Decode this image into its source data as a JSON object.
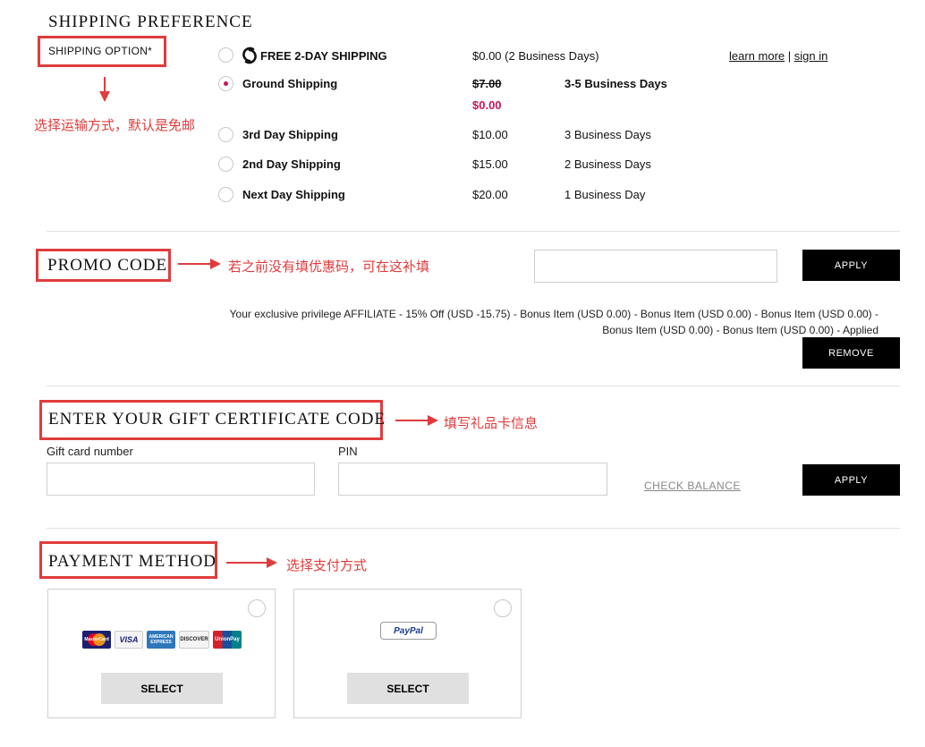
{
  "shipping": {
    "title": "SHIPPING PREFERENCE",
    "option_label": "SHIPPING OPTION*",
    "note": "选择运输方式，默认是免邮",
    "options": [
      {
        "name": "FREE 2-DAY SHIPPING",
        "price": "$0.00 (2 Business Days)",
        "icon": "shoprunner-s-icon"
      },
      {
        "name": "Ground Shipping",
        "price_old": "$7.00",
        "price": "$0.00",
        "days": "3-5 Business Days",
        "selected": true
      },
      {
        "name": "3rd Day Shipping",
        "price": "$10.00",
        "days": "3 Business Days"
      },
      {
        "name": "2nd Day Shipping",
        "price": "$15.00",
        "days": "2 Business Days"
      },
      {
        "name": "Next Day Shipping",
        "price": "$20.00",
        "days": "1 Business Day"
      }
    ],
    "learn_more": "learn more",
    "separator": "|",
    "sign_in": "sign in"
  },
  "promo": {
    "title": "PROMO CODE",
    "note": "若之前没有填优惠码，可在这补填",
    "apply_label": "APPLY",
    "privilege_line1": "Your exclusive privilege AFFILIATE - 15% Off (USD -15.75) - Bonus Item (USD 0.00) - Bonus Item (USD 0.00) - Bonus Item (USD 0.00) -",
    "privilege_line2": "Bonus Item (USD 0.00) - Bonus Item (USD 0.00) - Applied",
    "remove_label": "REMOVE"
  },
  "gift": {
    "title": "ENTER YOUR GIFT CERTIFICATE CODE",
    "note": "填写礼品卡信息",
    "card_number_label": "Gift card number",
    "pin_label": "PIN",
    "check_balance": "CHECK BALANCE",
    "apply_label": "APPLY"
  },
  "payment": {
    "title": "PAYMENT METHOD",
    "note": "选择支付方式",
    "cards": {
      "mastercard": "MasterCard",
      "visa": "VISA",
      "amex": "AMERICAN EXPRESS",
      "discover": "DISCOVER",
      "unionpay": "UnionPay"
    },
    "paypal": "PayPal",
    "select_label": "SELECT"
  },
  "colors": {
    "annotation_red": "#e03c3c",
    "accent_pink": "#c8155e",
    "button_black": "#000000"
  }
}
